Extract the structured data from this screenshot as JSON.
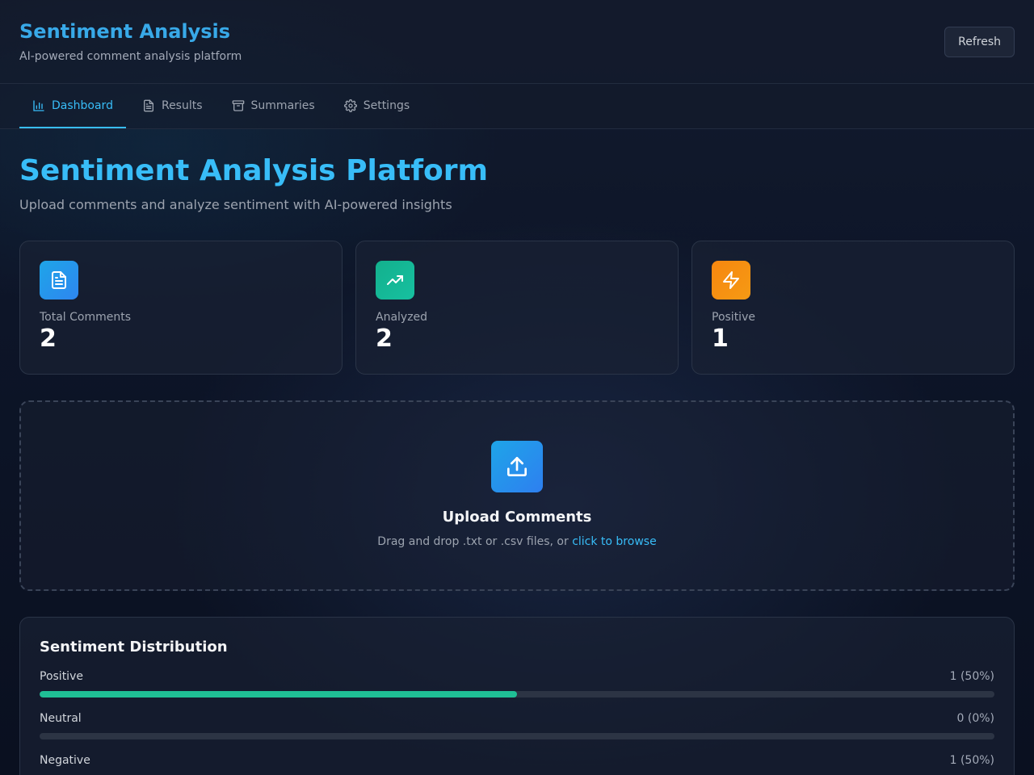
{
  "header": {
    "title": "Sentiment Analysis",
    "subtitle": "AI-powered comment analysis platform",
    "refresh_label": "Refresh"
  },
  "tabs": [
    {
      "label": "Dashboard",
      "icon": "bar-chart-icon",
      "active": true
    },
    {
      "label": "Results",
      "icon": "document-icon",
      "active": false
    },
    {
      "label": "Summaries",
      "icon": "archive-icon",
      "active": false
    },
    {
      "label": "Settings",
      "icon": "gear-icon",
      "active": false
    }
  ],
  "main": {
    "title": "Sentiment Analysis Platform",
    "subtitle": "Upload comments and analyze sentiment with AI-powered insights"
  },
  "stats": [
    {
      "label": "Total Comments",
      "value": "2",
      "icon": "document-icon",
      "color": "#1ea5e8"
    },
    {
      "label": "Analyzed",
      "value": "2",
      "icon": "trending-up-icon",
      "color": "#13b08d"
    },
    {
      "label": "Positive",
      "value": "1",
      "icon": "zap-icon",
      "color": "#f7870f"
    }
  ],
  "upload": {
    "title": "Upload Comments",
    "text": "Drag and drop .txt or .csv files, or ",
    "link": "click to browse"
  },
  "distribution": {
    "title": "Sentiment Distribution",
    "rows": [
      {
        "label": "Positive",
        "count": "1 (50%)",
        "fraction": 0.5,
        "color": "#1fbf95"
      },
      {
        "label": "Neutral",
        "count": "0 (0%)",
        "fraction": 0,
        "color": "#9ca3af"
      },
      {
        "label": "Negative",
        "count": "1 (50%)",
        "fraction": 0.5,
        "color": "#ef4444"
      }
    ]
  }
}
